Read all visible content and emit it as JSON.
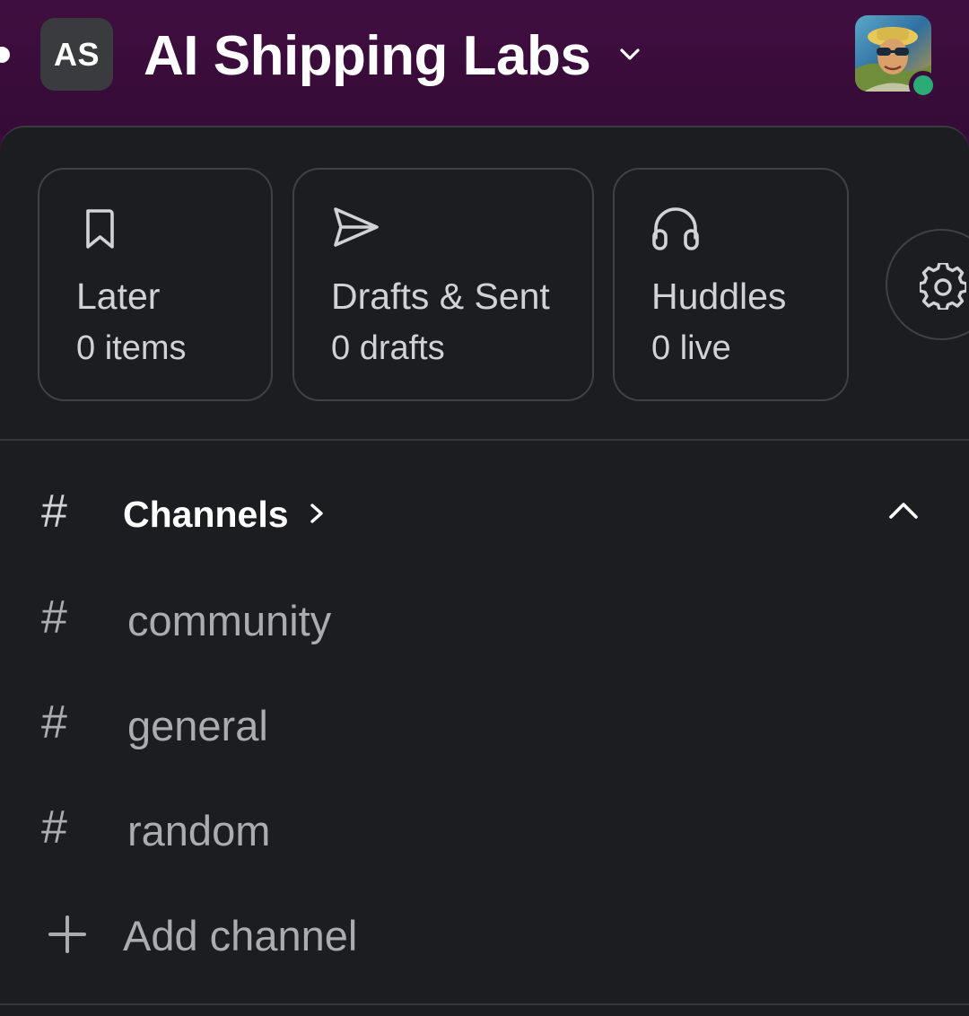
{
  "header": {
    "workspace_initials": "AS",
    "workspace_name": "AI Shipping Labs",
    "avatar_alt": "User avatar",
    "presence_status": "active"
  },
  "shortcuts": [
    {
      "icon": "bookmark-icon",
      "title": "Later",
      "subtitle": "0 items"
    },
    {
      "icon": "send-icon",
      "title": "Drafts & Sent",
      "subtitle": "0 drafts"
    },
    {
      "icon": "headphones-icon",
      "title": "Huddles",
      "subtitle": "0 live"
    }
  ],
  "settings": {
    "icon": "gear-icon"
  },
  "channels_section": {
    "title": "Channels",
    "items": [
      {
        "name": "community"
      },
      {
        "name": "general"
      },
      {
        "name": "random"
      }
    ],
    "add_label": "Add channel"
  },
  "colors": {
    "header_bg": "#3f0e40",
    "panel_bg": "#1b1d21",
    "text_primary": "#ffffff",
    "text_secondary": "#abacad",
    "presence_active": "#2bac76"
  }
}
